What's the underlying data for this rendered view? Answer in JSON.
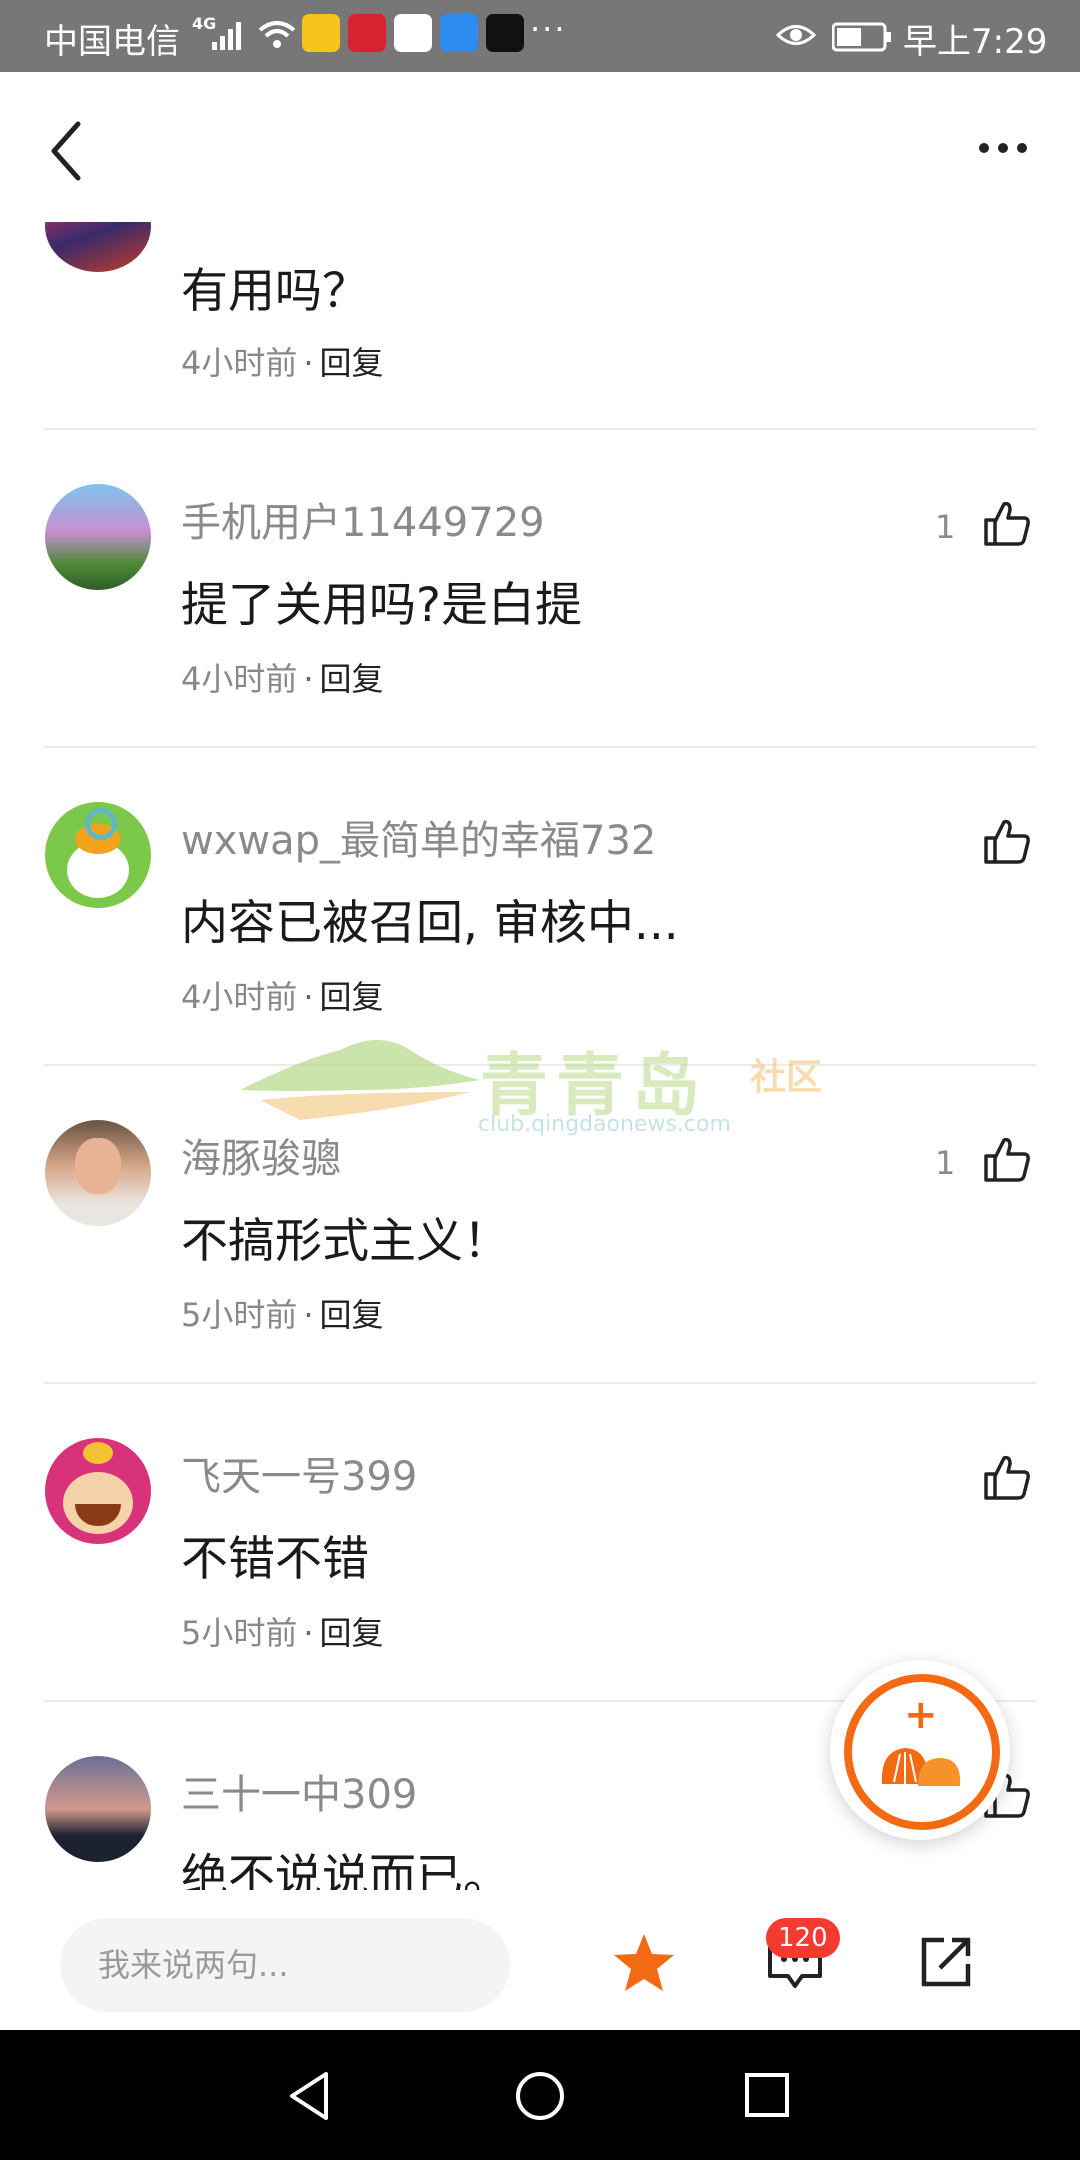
{
  "status_bar": {
    "carrier": "中国电信",
    "network": "4G",
    "more": "···",
    "time": "早上7:29"
  },
  "header": {
    "back_icon": "chevron-left-icon",
    "more_icon": "more-horizontal-icon"
  },
  "comments": [
    {
      "name": "",
      "text": "有用吗？",
      "time": "4小时前",
      "reply": "回复",
      "likes": ""
    },
    {
      "name": "手机用户11449729",
      "text": "提了关用吗?是白提",
      "time": "4小时前",
      "reply": "回复",
      "likes": "1"
    },
    {
      "name": "wxwap_最简单的幸福732",
      "text": "内容已被召回, 审核中...",
      "time": "4小时前",
      "reply": "回复",
      "likes": ""
    },
    {
      "name": "海豚骏骢",
      "text": "不搞形式主义！",
      "time": "5小时前",
      "reply": "回复",
      "likes": "1"
    },
    {
      "name": "飞天一号399",
      "text": "不错不错",
      "time": "5小时前",
      "reply": "回复",
      "likes": ""
    },
    {
      "name": "三十一中309",
      "text": "绝不说说而已。",
      "time": "",
      "reply": "",
      "likes": ""
    }
  ],
  "watermark": {
    "title": "青青岛",
    "subtitle": "社区",
    "url": "club.qingdaonews.com"
  },
  "fab": {
    "plus": "+"
  },
  "bottom_bar": {
    "input_placeholder": "我来说两句...",
    "comment_count": "120"
  },
  "colors": {
    "accent": "#f36a12",
    "badge": "#f53a2f",
    "status_bar": "#777777"
  }
}
